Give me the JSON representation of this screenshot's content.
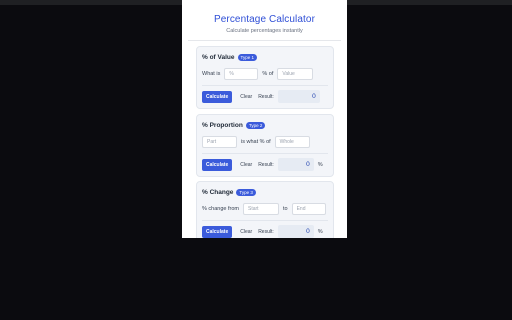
{
  "header": {
    "title": "Percentage Calculator",
    "subtitle": "Calculate percentages instantly"
  },
  "cards": [
    {
      "title": "% of Value",
      "badge": "Type 1",
      "label_a": "What is",
      "input_a_placeholder": "%",
      "label_b": "% of",
      "input_b_placeholder": "Value",
      "calc_label": "Calculate",
      "clear_label": "Clear",
      "result_label": "Result:",
      "result_value": "0",
      "unit": ""
    },
    {
      "title": "% Proportion",
      "badge": "Type 2",
      "input_a_placeholder": "Part",
      "label_b": "is what % of",
      "input_b_placeholder": "Whole",
      "calc_label": "Calculate",
      "clear_label": "Clear",
      "result_label": "Result:",
      "result_value": "0",
      "unit": "%"
    },
    {
      "title": "% Change",
      "badge": "Type 3",
      "label_a": "% change from",
      "input_a_placeholder": "Start",
      "label_b": "to",
      "input_b_placeholder": "End",
      "calc_label": "Calculate",
      "clear_label": "Clear",
      "result_label": "Result:",
      "result_value": "0",
      "unit": "%"
    }
  ]
}
